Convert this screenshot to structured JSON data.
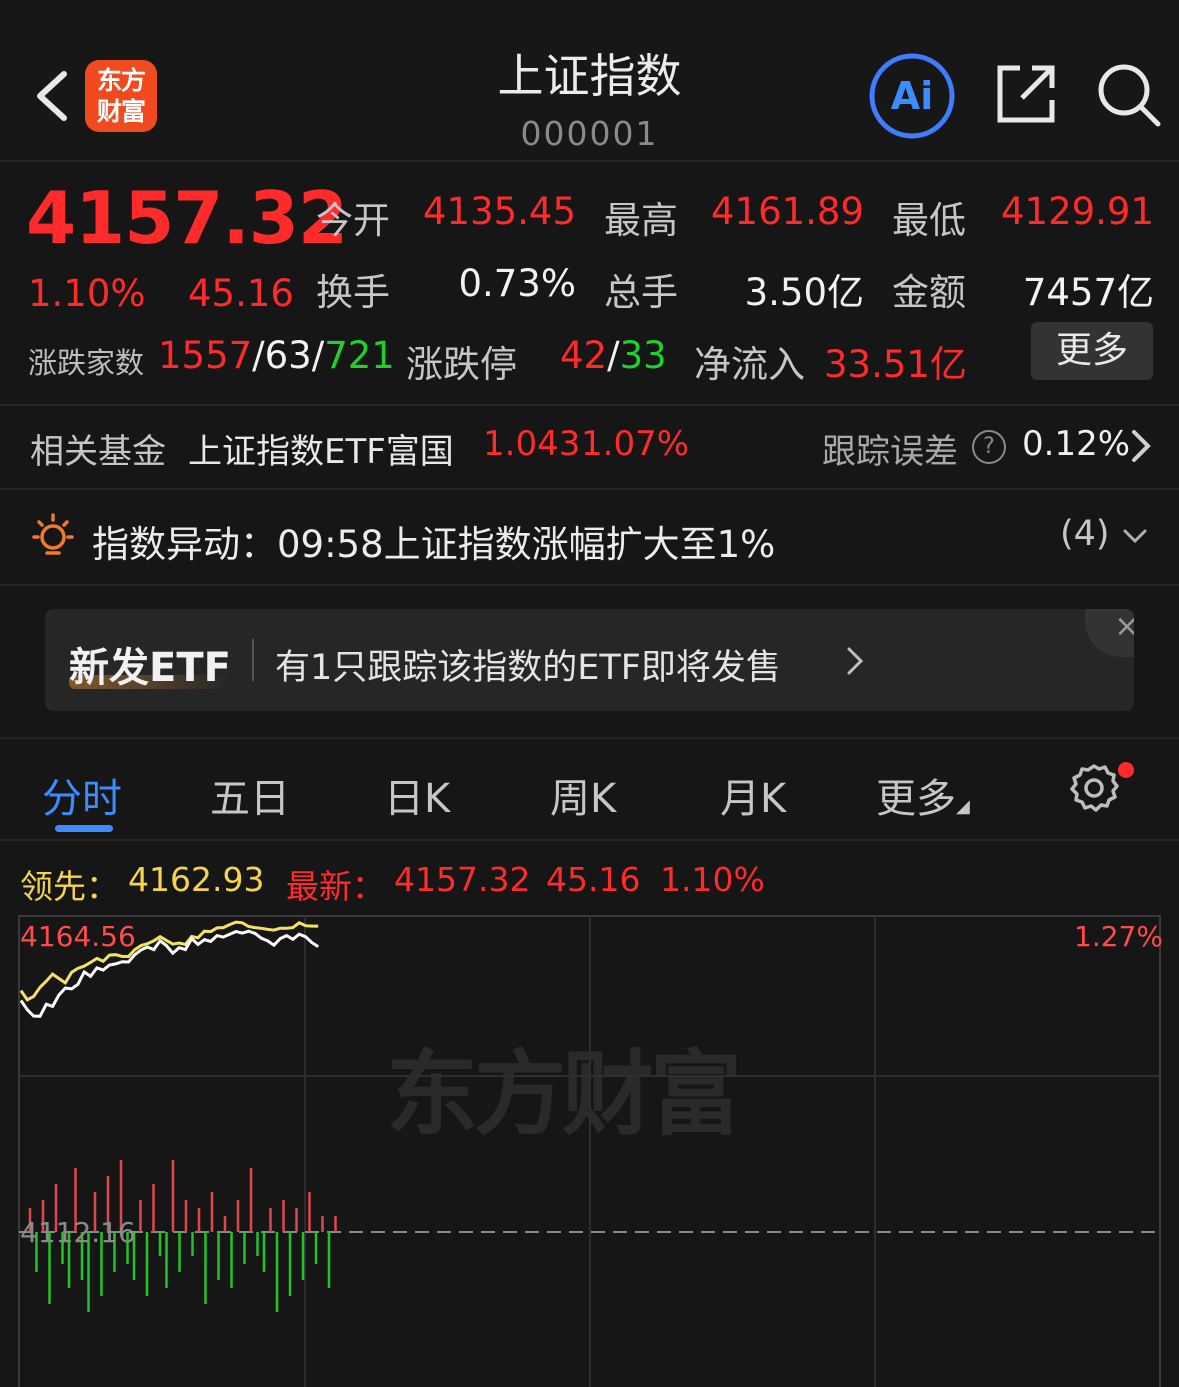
{
  "header": {
    "title": "上证指数",
    "code": "000001",
    "logo_line1": "东方",
    "logo_line2": "财富",
    "ai_label": "Ai"
  },
  "quote": {
    "price": "4157.32",
    "pct": "1.10%",
    "change": "45.16",
    "open_label": "今开",
    "open": "4135.45",
    "high_label": "最高",
    "high": "4161.89",
    "low_label": "最低",
    "low": "4129.91",
    "turnover_label": "换手",
    "turnover": "0.73%",
    "volume_label": "总手",
    "volume": "3.50亿",
    "amount_label": "金额",
    "amount": "7457亿",
    "breadth_label": "涨跌家数",
    "up_count": "1557",
    "flat_count": "63",
    "down_count": "721",
    "limit_label": "涨跌停",
    "limit_up": "42",
    "limit_down": "33",
    "netflow_label": "净流入",
    "netflow": "33.51亿",
    "more_label": "更多"
  },
  "fund": {
    "label": "相关基金",
    "name": "上证指数ETF富国",
    "price": "1.043",
    "pct": "1.07%",
    "tracking_label": "跟踪误差",
    "tracking_value": "0.12%"
  },
  "alert": {
    "text": "指数异动：09:58上证指数涨幅扩大至1%",
    "count": "(4)"
  },
  "promo": {
    "tag": "新发ETF",
    "text": "有1只跟踪该指数的ETF即将发售",
    "close": "×"
  },
  "tabs": [
    {
      "label": "分时"
    },
    {
      "label": "五日"
    },
    {
      "label": "日K"
    },
    {
      "label": "周K"
    },
    {
      "label": "月K"
    },
    {
      "label": "更多"
    }
  ],
  "chart_info": {
    "lead_label": "领先：",
    "lead_value": "4162.93",
    "latest_label": "最新：",
    "latest_value": "4157.32",
    "latest_change": "45.16",
    "latest_pct": "1.10%",
    "ymax_label": "4164.56",
    "ymax_pct": "1.27%",
    "base_label": "4112.16",
    "watermark": "东方财富"
  },
  "chart_data": {
    "type": "line",
    "ylim": [
      4112.16,
      4164.56
    ],
    "base": 4112.16,
    "colors": {
      "price": "#ffffff",
      "lead": "#f4e264",
      "up": "#e0474c",
      "down": "#22c325"
    },
    "price": [
      4142.6,
      4140.1,
      4138.4,
      4138.3,
      4141.6,
      4141.0,
      4144.1,
      4146.0,
      4145.8,
      4147.0,
      4150.4,
      4149.2,
      4151.5,
      4150.9,
      4152.3,
      4152.6,
      4153.2,
      4153.1,
      4155.1,
      4156.4,
      4157.2,
      4156.5,
      4158.9,
      4157.6,
      4155.5,
      4157.0,
      4156.5,
      4159.5,
      4157.9,
      4159.2,
      4158.7,
      4160.3,
      4159.9,
      4160.7,
      4161.4,
      4161.0,
      4161.5,
      4160.9,
      4159.6,
      4158.9,
      4157.7,
      4159.5,
      4160.3,
      4159.3,
      4160.7,
      4160.0,
      4158.4,
      4157.3
    ],
    "lead": [
      4145.3,
      4142.8,
      4143.7,
      4146.2,
      4147.9,
      4149.8,
      4148.6,
      4147.4,
      4150.3,
      4151.4,
      4152.0,
      4153.0,
      4154.1,
      4153.3,
      4155.0,
      4155.1,
      4154.6,
      4154.6,
      4156.5,
      4157.6,
      4158.1,
      4158.9,
      4160.0,
      4159.0,
      4158.0,
      4158.3,
      4157.9,
      4160.1,
      4159.7,
      4161.5,
      4161.4,
      4162.4,
      4162.5,
      4163.3,
      4164.0,
      4163.8,
      4162.8,
      4162.5,
      4162.3,
      4162.0,
      4161.8,
      4162.3,
      4162.3,
      4162.5,
      4163.8,
      4163.0,
      4162.9,
      4162.9
    ],
    "volume_bars": [
      0.3,
      -0.5,
      0.4,
      -0.9,
      0.6,
      -0.4,
      -0.7,
      0.8,
      -0.6,
      -1.0,
      0.5,
      -0.8,
      0.7,
      -0.5,
      0.9,
      -0.4,
      -0.6,
      0.4,
      -0.8,
      0.6,
      -0.3,
      -0.7,
      0.9,
      -0.5,
      0.4,
      -0.3,
      0.3,
      -0.9,
      0.5,
      -0.6,
      0.2,
      -0.7,
      0.4,
      -0.4,
      0.8,
      -0.3,
      -0.5,
      0.3,
      -1.0,
      0.4,
      -0.8,
      0.3,
      -0.6,
      0.5,
      -0.4,
      0.2,
      -0.7,
      0.2
    ],
    "n_total": 241
  }
}
